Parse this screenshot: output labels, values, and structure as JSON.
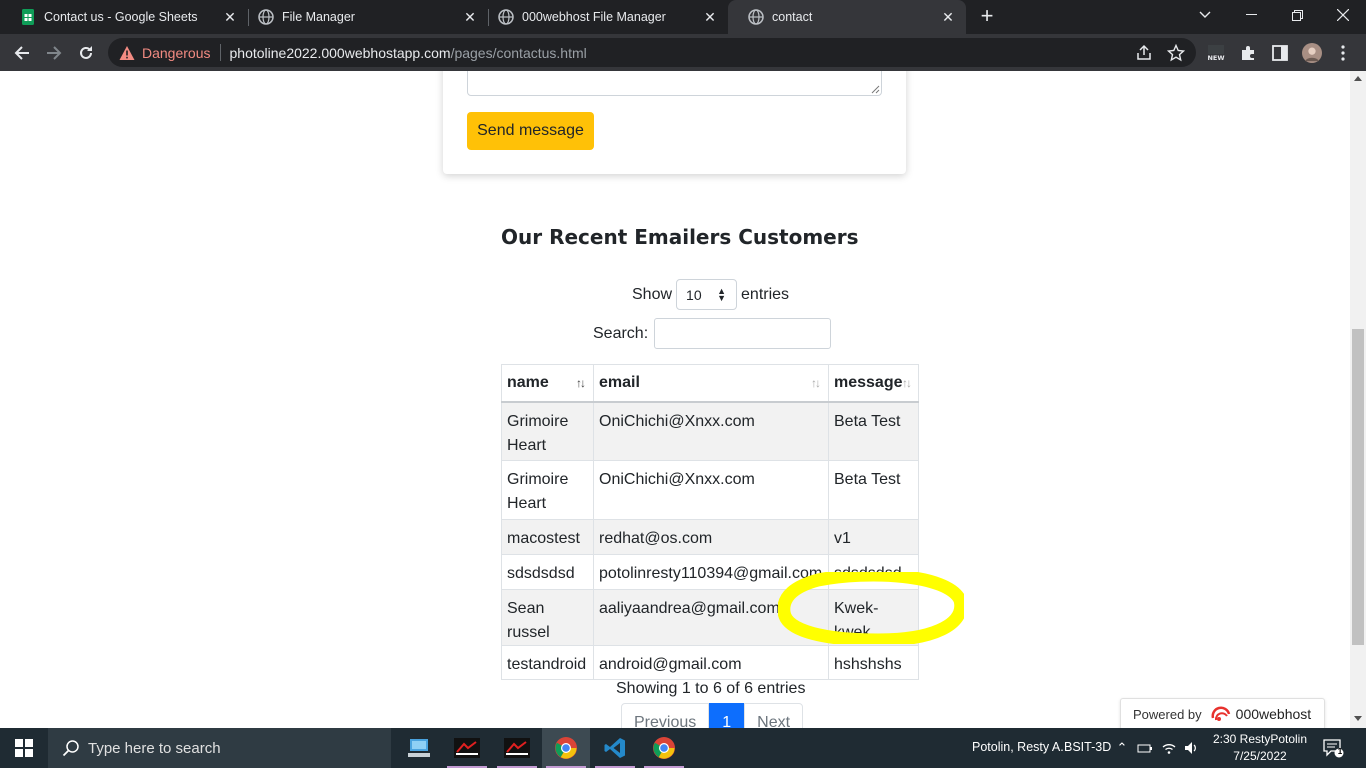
{
  "browser": {
    "tabs": [
      {
        "label": "Contact us - Google Sheets",
        "icon": "google-sheets-icon",
        "active": false
      },
      {
        "label": "File Manager",
        "icon": "globe-icon",
        "active": false
      },
      {
        "label": "000webhost File Manager",
        "icon": "globe-icon",
        "active": false
      },
      {
        "label": "contact",
        "icon": "globe-icon",
        "active": true
      }
    ],
    "close_glyph": "✕",
    "new_tab_glyph": "+",
    "security_label": "Dangerous",
    "url_host": "photoline2022.000webhostapp.com",
    "url_path": "/pages/contactus.html"
  },
  "form": {
    "send_label": "Send message"
  },
  "section": {
    "heading": "Our Recent Emailers Customers"
  },
  "datatable": {
    "show_label": "Show",
    "entries_label": "entries",
    "page_length": "10",
    "search_label": "Search:",
    "search_value": "",
    "columns": [
      "name",
      "email",
      "message"
    ],
    "rows": [
      {
        "name": "Grimoire Heart",
        "email": "OniChichi@Xnxx.com",
        "message": "Beta Test"
      },
      {
        "name": "Grimoire Heart",
        "email": "OniChichi@Xnxx.com",
        "message": "Beta Test"
      },
      {
        "name": "macostest",
        "email": "redhat@os.com",
        "message": "v1"
      },
      {
        "name": "sdsdsdsd",
        "email": "potolinresty110394@gmail.com",
        "message": "sdsdsdsd"
      },
      {
        "name": "Sean russel",
        "email": "aaliyaandrea@gmail.com",
        "message": "Kwek-kwek"
      },
      {
        "name": "testandroid",
        "email": "android@gmail.com",
        "message": "hshshshs"
      }
    ],
    "info": "Showing 1 to 6 of 6 entries",
    "pager": {
      "previous": "Previous",
      "current": "1",
      "next": "Next"
    }
  },
  "powered": {
    "label": "Powered by",
    "brand": "000webhost"
  },
  "taskbar": {
    "search_placeholder": "Type here to search",
    "user": "Potolin, Resty A.",
    "section": "BSIT-3D",
    "time": "2:30 RestyPotolin",
    "date": "7/25/2022",
    "notification_count": "1"
  },
  "colors": {
    "accent_button": "#ffc107",
    "pager_active": "#0d6efd",
    "highlight": "#ffff00",
    "danger": "#f28b82"
  }
}
